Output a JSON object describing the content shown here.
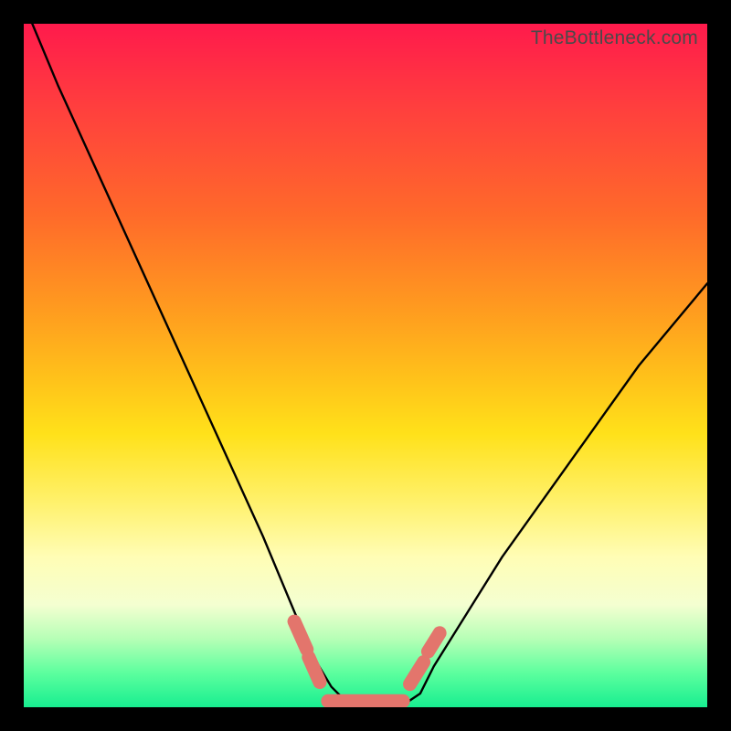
{
  "watermark": "TheBottleneck.com",
  "chart_data": {
    "type": "line",
    "title": "",
    "xlabel": "",
    "ylabel": "",
    "xlim": [
      0,
      100
    ],
    "ylim": [
      0,
      100
    ],
    "legend": false,
    "grid": false,
    "series": [
      {
        "name": "bottleneck-curve",
        "x": [
          0,
          5,
          10,
          15,
          20,
          25,
          30,
          35,
          40,
          42,
          45,
          48,
          50,
          52,
          55,
          58,
          60,
          65,
          70,
          75,
          80,
          85,
          90,
          95,
          100
        ],
        "y": [
          103,
          91,
          80,
          69,
          58,
          47,
          36,
          25,
          13,
          8,
          3,
          0,
          0,
          0,
          0,
          2,
          6,
          14,
          22,
          29,
          36,
          43,
          50,
          56,
          62
        ]
      }
    ],
    "markers": [
      {
        "name": "marker-left-upper",
        "x": 40.5,
        "y": 10.5,
        "angle": -66,
        "len": 4.5
      },
      {
        "name": "marker-left-lower",
        "x": 42.5,
        "y": 5.5,
        "angle": -66,
        "len": 4.0
      },
      {
        "name": "marker-bottom",
        "x": 50,
        "y": 0.9,
        "angle": 0,
        "len": 11
      },
      {
        "name": "marker-right-lower",
        "x": 57.5,
        "y": 5.0,
        "angle": 58,
        "len": 3.8
      },
      {
        "name": "marker-right-upper",
        "x": 60.0,
        "y": 9.5,
        "angle": 58,
        "len": 3.2
      }
    ],
    "colors": {
      "curve": "#000000",
      "marker": "#e3756c"
    }
  }
}
